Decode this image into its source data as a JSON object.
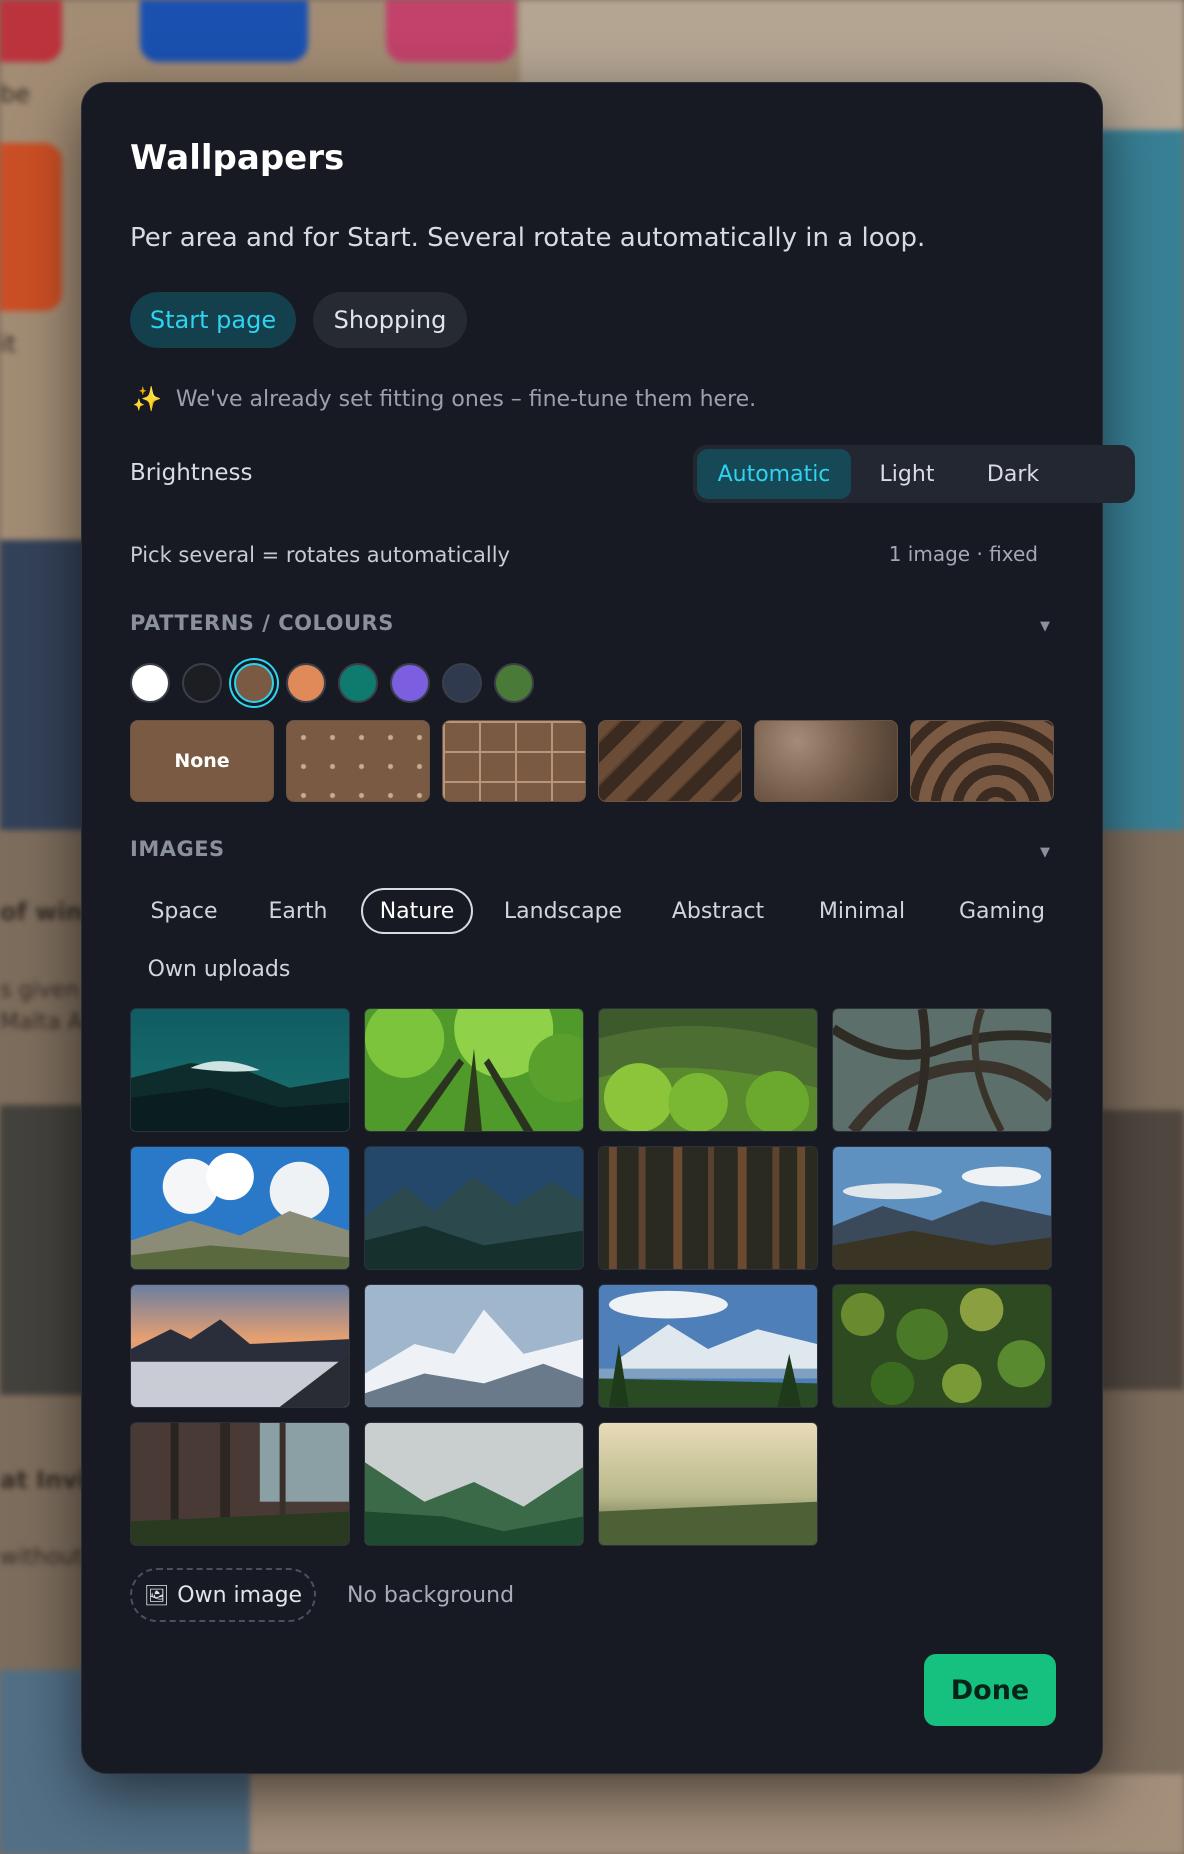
{
  "background": {
    "fragments": [
      "be",
      "it",
      "of win",
      "s given",
      "Malta A",
      "at Invic",
      "without"
    ]
  },
  "modal": {
    "title": "Wallpapers",
    "subtitle": "Per area and for Start. Several rotate automatically in a loop.",
    "area_tabs": [
      "Start page",
      "Shopping"
    ],
    "active_area": "Start page",
    "hint": "We've already set fitting ones – fine-tune them here.",
    "brightness": {
      "label": "Brightness",
      "options": [
        "Automatic",
        "Light",
        "Dark"
      ],
      "selected": "Automatic"
    },
    "pick_label": "Pick several = rotates automatically",
    "selection_status": "1 image · fixed",
    "patterns_section": {
      "heading": "PATTERNS / COLOURS",
      "swatches": [
        "#ffffff",
        "#1c1e22",
        "#7a5a43",
        "#e08a5a",
        "#0f7a6e",
        "#7b5fe0",
        "#2f3a4e",
        "#4a7a38"
      ],
      "selected_swatch": "#7a5a43",
      "patterns": [
        "None",
        "dots",
        "grid",
        "stripes",
        "gradient",
        "arcs"
      ],
      "none_label": "None"
    },
    "images_section": {
      "heading": "IMAGES",
      "categories": [
        "Space",
        "Earth",
        "Nature",
        "Landscape",
        "Abstract",
        "Minimal",
        "Gaming",
        "Own uploads"
      ],
      "selected_category": "Nature",
      "image_count": 15
    },
    "own_image_label": "Own image",
    "no_background_label": "No background",
    "done_label": "Done"
  },
  "colors": {
    "accent": "#2ed3f0",
    "done_green": "#16c07e",
    "modal_bg": "#171a22"
  }
}
